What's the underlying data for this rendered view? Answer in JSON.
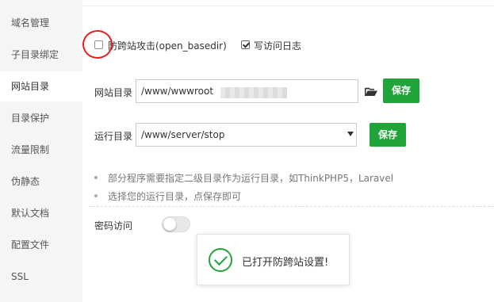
{
  "sidebar": {
    "items": [
      {
        "label": "域名管理"
      },
      {
        "label": "子目录绑定"
      },
      {
        "label": "网站目录"
      },
      {
        "label": "目录保护"
      },
      {
        "label": "流量限制"
      },
      {
        "label": "伪静态"
      },
      {
        "label": "默认文档"
      },
      {
        "label": "配置文件"
      },
      {
        "label": "SSL"
      }
    ],
    "active_index": 2
  },
  "options": {
    "basedir_label": "防跨站攻击(open_basedir)",
    "basedir_checked": false,
    "log_label": "写访问日志",
    "log_checked": true
  },
  "site_dir": {
    "label": "网站目录",
    "value": "/www/wwwroot",
    "save_label": "保存"
  },
  "run_dir": {
    "label": "运行目录",
    "selected": "/www/server/stop",
    "save_label": "保存"
  },
  "tips": [
    "部分程序需要指定二级目录作为运行目录，如ThinkPHP5，Laravel",
    "选择您的运行目录，点保存即可"
  ],
  "password_access": {
    "label": "密码访问",
    "enabled": false
  },
  "toast": {
    "message": "已打开防跨站设置!"
  },
  "colors": {
    "accent": "#20a53a",
    "highlight_circle": "#e02020"
  }
}
